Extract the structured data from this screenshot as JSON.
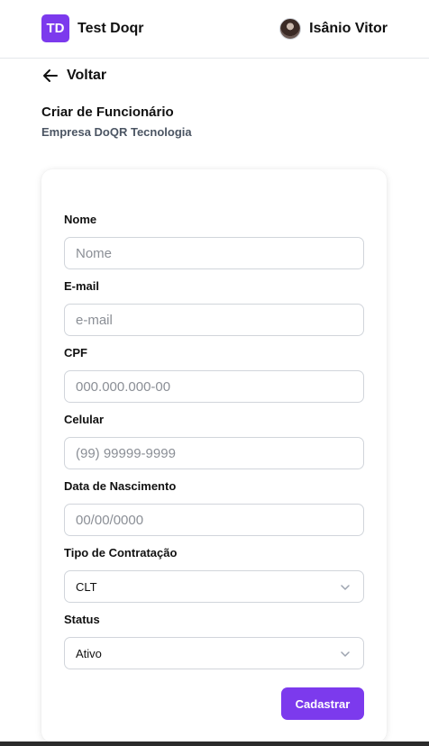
{
  "header": {
    "brand_initials": "TD",
    "brand_name": "Test Doqr",
    "user_name": "Isânio Vitor"
  },
  "nav": {
    "back_label": "Voltar"
  },
  "page": {
    "title": "Criar de Funcionário",
    "subtitle": "Empresa DoQR Tecnologia"
  },
  "form": {
    "name": {
      "label": "Nome",
      "placeholder": "Nome"
    },
    "email": {
      "label": "E-mail",
      "placeholder": "e-mail"
    },
    "cpf": {
      "label": "CPF",
      "placeholder": "000.000.000-00"
    },
    "phone": {
      "label": "Celular",
      "placeholder": "(99) 99999-9999"
    },
    "birth": {
      "label": "Data de Nascimento",
      "placeholder": "00/00/0000"
    },
    "contract_type": {
      "label": "Tipo de Contratação",
      "value": "CLT"
    },
    "status": {
      "label": "Status",
      "value": "Ativo"
    },
    "submit_label": "Cadastrar"
  },
  "colors": {
    "accent": "#7c3aed",
    "border": "#d1d5db",
    "subtle_text": "#4b5563"
  }
}
